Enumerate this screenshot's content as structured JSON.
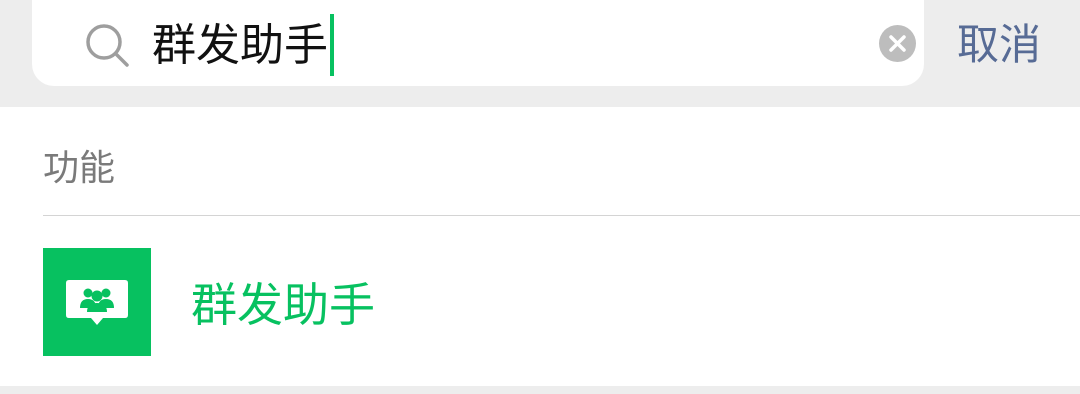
{
  "search": {
    "query": "群发助手",
    "cancel_label": "取消"
  },
  "results": {
    "section_label": "功能",
    "items": [
      {
        "title": "群发助手",
        "icon": "broadcast-group-icon"
      }
    ]
  },
  "colors": {
    "accent": "#07c160",
    "link": "#576b95",
    "background": "#ededed"
  }
}
